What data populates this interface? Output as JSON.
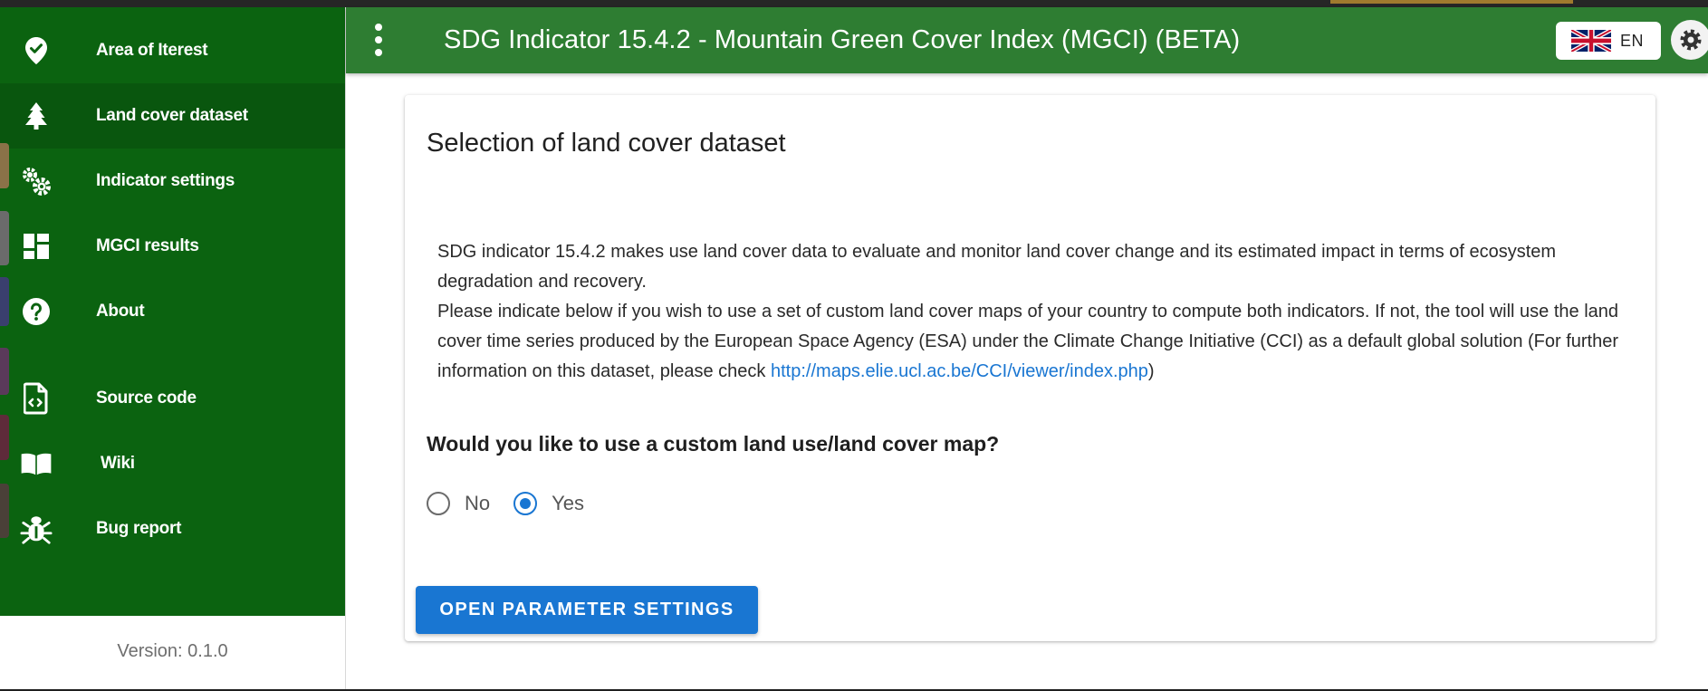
{
  "header": {
    "title": "SDG Indicator 15.4.2 - Mountain Green Cover Index (MGCI) (BETA)",
    "language_code": "EN",
    "colors": {
      "header_bg": "#2e7d32",
      "sidebar_bg": "#0b6310",
      "accent": "#1976d2"
    }
  },
  "sidebar": {
    "items": [
      {
        "label": "Area of Iterest",
        "icon": "map-check-icon"
      },
      {
        "label": "Land cover dataset",
        "icon": "pine-tree-icon",
        "active": true
      },
      {
        "label": "Indicator settings",
        "icon": "cogs-icon"
      },
      {
        "label": "MGCI results",
        "icon": "dashboard-icon"
      },
      {
        "label": "About",
        "icon": "help-circle-icon"
      },
      {
        "label": "Source code",
        "icon": "file-code-icon"
      },
      {
        "label": "Wiki",
        "icon": "book-open-icon"
      },
      {
        "label": "Bug report",
        "icon": "bug-icon"
      }
    ],
    "version": "Version: 0.1.0"
  },
  "main": {
    "card_title": "Selection of land cover dataset",
    "description": {
      "p1": "SDG indicator 15.4.2 makes use land cover data to evaluate and monitor land cover change and its estimated impact in terms of ecosystem degradation and recovery.",
      "p2_before_link": "Please indicate below if you wish to use a set of custom land cover maps of your country to compute both indicators. If not, the tool will use the land cover time series produced by the European Space Agency (ESA) under the Climate Change Initiative (CCI) as a default global solution (For further information on this dataset, please check ",
      "link": "http://maps.elie.ucl.ac.be/CCI/viewer/index.php",
      "p2_after_link": ")"
    },
    "question": "Would you like to use a custom land use/land cover map?",
    "radio_options": [
      {
        "label": "No",
        "checked": false
      },
      {
        "label": "Yes",
        "checked": true
      }
    ],
    "button_label": "OPEN PARAMETER SETTINGS"
  }
}
